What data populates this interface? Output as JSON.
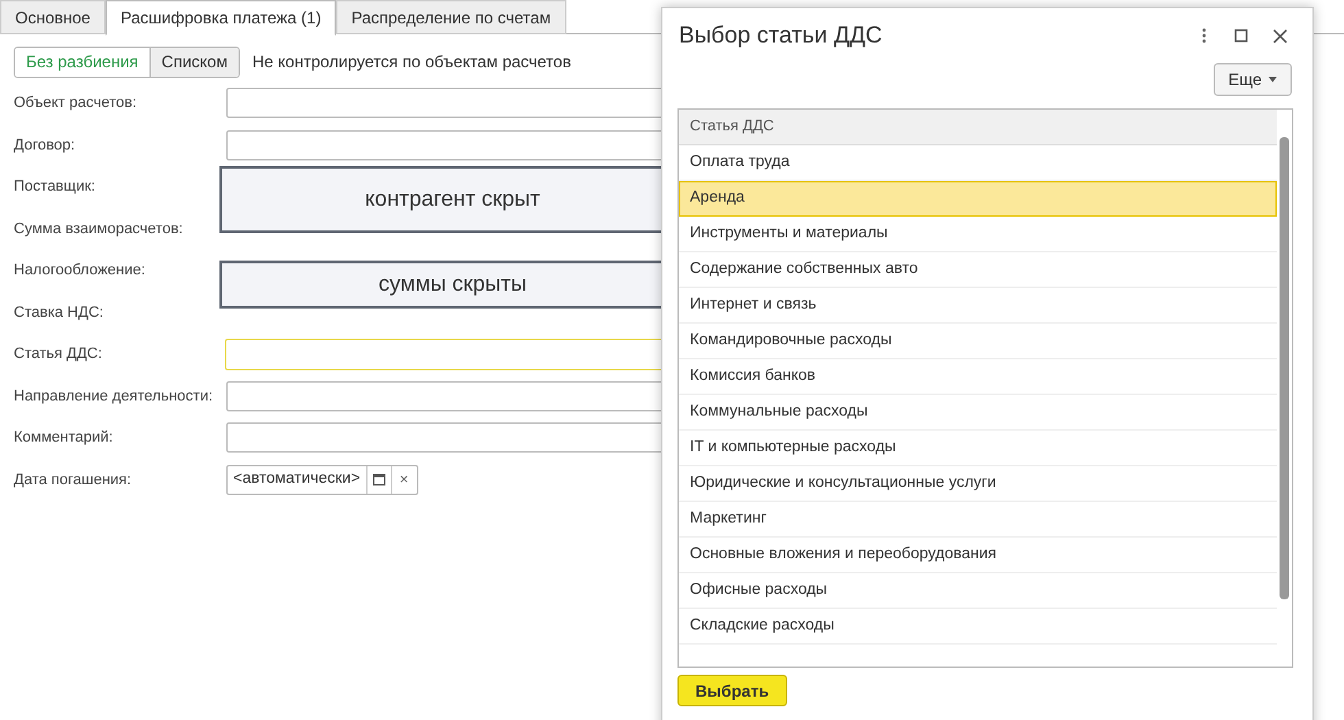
{
  "tabs": [
    {
      "label": "Основное",
      "selected": false
    },
    {
      "label": "Расшифровка платежа (1)",
      "selected": true
    },
    {
      "label": "Распределение по счетам",
      "selected": false
    }
  ],
  "mode_buttons": [
    {
      "label": "Без разбиения",
      "selected": true
    },
    {
      "label": "Списком",
      "selected": false
    }
  ],
  "control_note": "Не контролируется по объектам расчетов",
  "fields": [
    {
      "label": "Объект расчетов:",
      "kind": "text"
    },
    {
      "label": "Договор:",
      "kind": "text"
    },
    {
      "label": "Поставщик:",
      "kind": "covered"
    },
    {
      "label": "Сумма взаиморасчетов:",
      "kind": "covered"
    },
    {
      "label": "Налогообложение:",
      "kind": "covered"
    },
    {
      "label": "Ставка НДС:",
      "kind": "covered"
    },
    {
      "label": "Статья ДДС:",
      "kind": "focused"
    },
    {
      "label": "Направление деятельности:",
      "kind": "text"
    },
    {
      "label": "Комментарий:",
      "kind": "text"
    },
    {
      "label": "Дата погашения:",
      "kind": "date",
      "value": "<автоматически>",
      "clear": "×"
    }
  ],
  "overlays": [
    {
      "text": "контрагент скрыт"
    },
    {
      "text": "суммы скрыты"
    }
  ],
  "dialog": {
    "title": "Выбор статьи ДДС",
    "more_button": "Еще",
    "column": "Статья ДДС",
    "rows": [
      {
        "text": "Оплата труда",
        "selected": false
      },
      {
        "text": "Аренда",
        "selected": true
      },
      {
        "text": "Инструменты и материалы",
        "selected": false
      },
      {
        "text": "Содержание собственных авто",
        "selected": false
      },
      {
        "text": "Интернет и связь",
        "selected": false
      },
      {
        "text": "Командировочные расходы",
        "selected": false
      },
      {
        "text": "Комиссия банков",
        "selected": false
      },
      {
        "text": "Коммунальные расходы",
        "selected": false
      },
      {
        "text": "IT и компьютерные расходы",
        "selected": false
      },
      {
        "text": "Юридические и консультационные услуги",
        "selected": false
      },
      {
        "text": "Маркетинг",
        "selected": false
      },
      {
        "text": "Основные вложения и переоборудования",
        "selected": false
      },
      {
        "text": "Офисные расходы",
        "selected": false
      },
      {
        "text": "Складские расходы",
        "selected": false
      }
    ],
    "choose_button": "Выбрать"
  }
}
